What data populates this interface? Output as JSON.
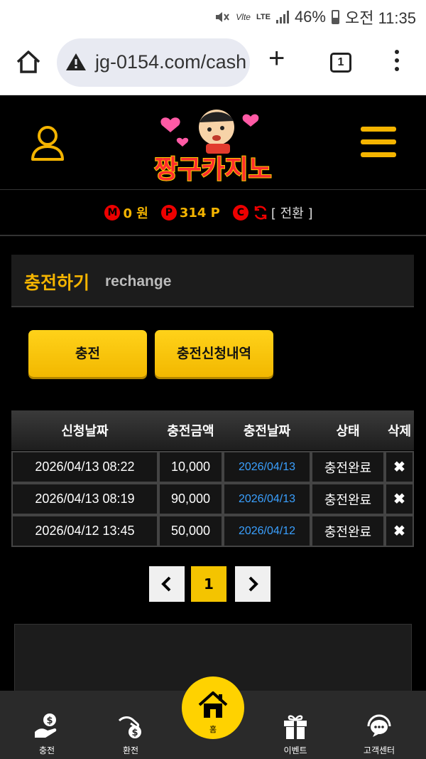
{
  "status_bar": {
    "battery_percent": "46%",
    "time": "오전 11:35",
    "network": "LTE",
    "volte": "Vlte"
  },
  "browser": {
    "url": "jg-0154.com/cash",
    "tab_count": "1"
  },
  "header": {
    "logo_text": "짱구카지노"
  },
  "balance": {
    "money_badge": "M",
    "money_value": "0 원",
    "point_badge": "P",
    "point_value": "314 P",
    "casino_badge": "C",
    "convert_label": "[ 전환 ]"
  },
  "section": {
    "title_ko": "충전하기",
    "title_en": "rechange"
  },
  "buttons": {
    "charge": "충전",
    "history": "충전신청내역"
  },
  "table": {
    "headers": [
      "신청날짜",
      "충전금액",
      "충전날짜",
      "상태",
      "삭제"
    ],
    "rows": [
      {
        "request_date": "2026/04/13 08:22",
        "amount": "10,000",
        "charge_date": "2026/04/13",
        "status": "충전완료",
        "delete": "✖"
      },
      {
        "request_date": "2026/04/13 08:19",
        "amount": "90,000",
        "charge_date": "2026/04/13",
        "status": "충전완료",
        "delete": "✖"
      },
      {
        "request_date": "2026/04/12 13:45",
        "amount": "50,000",
        "charge_date": "2026/04/12",
        "status": "충전완료",
        "delete": "✖"
      }
    ]
  },
  "pagination": {
    "current_page": "1"
  },
  "bottom_nav": {
    "deposit": "충전",
    "withdraw": "환전",
    "home": "홈",
    "event": "이벤트",
    "support": "고객센터"
  },
  "colors": {
    "accent": "#f4b400",
    "badge_red": "#e00000",
    "link_blue": "#3aa0ff",
    "background": "#000000"
  }
}
